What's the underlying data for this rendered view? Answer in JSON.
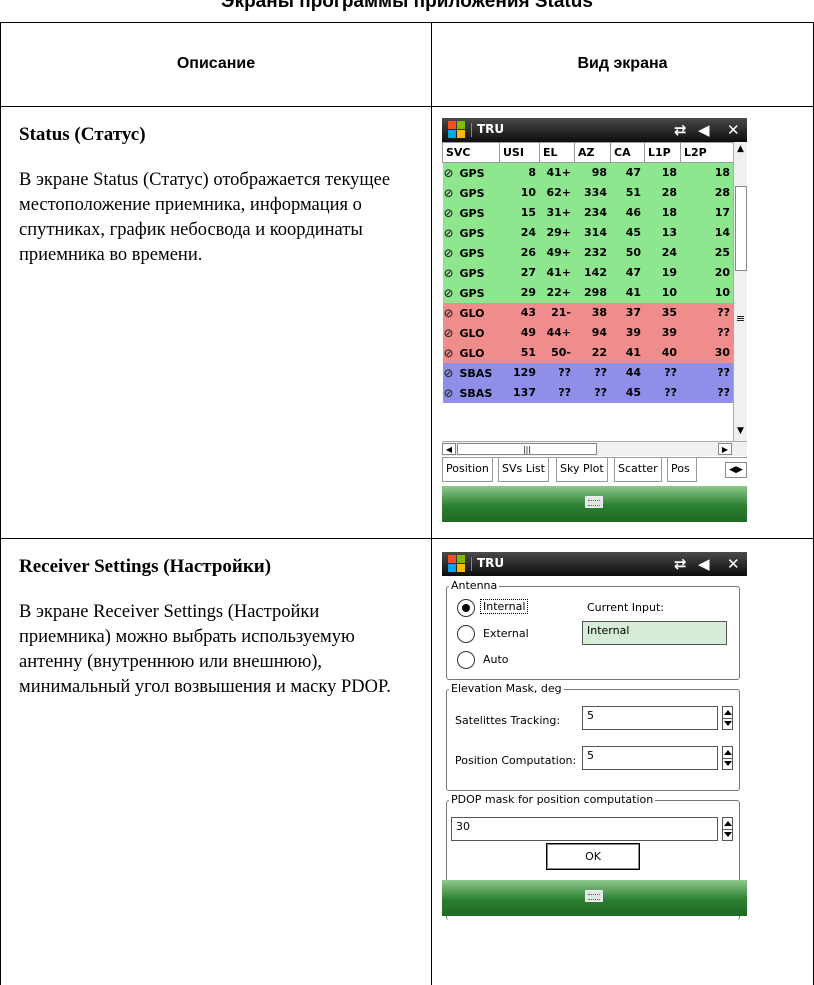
{
  "page_header": "Экраны программы приложения Status",
  "table": {
    "col1_header": "Описание",
    "col2_header": "Вид экрана",
    "rows": [
      {
        "title": "Status (Статус)",
        "text": "В экране Status (Статус) отображается текущее местоположение приемника, информация о спутниках, график небосвода и координаты приемника во времени."
      },
      {
        "title": "Receiver Settings (Настройки)",
        "text": "В экране Receiver Settings (Настройки приемника) можно выбрать используемую антенну (внутреннюю или внешнюю), минимальный угол возвышения и маску PDOP."
      }
    ]
  },
  "screen1": {
    "app_title": "TRU",
    "columns": [
      "SVC",
      "USI",
      "EL",
      "AZ",
      "CA",
      "L1P",
      "L2P"
    ],
    "rows": [
      {
        "type": "gps",
        "svc": "GPS",
        "usi": "8",
        "el": "41+",
        "az": "98",
        "ca": "47",
        "l1p": "18",
        "l2p": "18"
      },
      {
        "type": "gps",
        "svc": "GPS",
        "usi": "10",
        "el": "62+",
        "az": "334",
        "ca": "51",
        "l1p": "28",
        "l2p": "28"
      },
      {
        "type": "gps",
        "svc": "GPS",
        "usi": "15",
        "el": "31+",
        "az": "234",
        "ca": "46",
        "l1p": "18",
        "l2p": "17"
      },
      {
        "type": "gps",
        "svc": "GPS",
        "usi": "24",
        "el": "29+",
        "az": "314",
        "ca": "45",
        "l1p": "13",
        "l2p": "14"
      },
      {
        "type": "gps",
        "svc": "GPS",
        "usi": "26",
        "el": "49+",
        "az": "232",
        "ca": "50",
        "l1p": "24",
        "l2p": "25"
      },
      {
        "type": "gps",
        "svc": "GPS",
        "usi": "27",
        "el": "41+",
        "az": "142",
        "ca": "47",
        "l1p": "19",
        "l2p": "20"
      },
      {
        "type": "gps",
        "svc": "GPS",
        "usi": "29",
        "el": "22+",
        "az": "298",
        "ca": "41",
        "l1p": "10",
        "l2p": "10"
      },
      {
        "type": "glo",
        "svc": "GLO",
        "usi": "43",
        "el": "21-",
        "az": "38",
        "ca": "37",
        "l1p": "35",
        "l2p": "??"
      },
      {
        "type": "glo",
        "svc": "GLO",
        "usi": "49",
        "el": "44+",
        "az": "94",
        "ca": "39",
        "l1p": "39",
        "l2p": "??"
      },
      {
        "type": "glo",
        "svc": "GLO",
        "usi": "51",
        "el": "50-",
        "az": "22",
        "ca": "41",
        "l1p": "40",
        "l2p": "30"
      },
      {
        "type": "sbas",
        "svc": "SBAS",
        "usi": "129",
        "el": "??",
        "az": "??",
        "ca": "44",
        "l1p": "??",
        "l2p": "??"
      },
      {
        "type": "sbas",
        "svc": "SBAS",
        "usi": "137",
        "el": "??",
        "az": "??",
        "ca": "45",
        "l1p": "??",
        "l2p": "??"
      }
    ],
    "tabs": [
      "Position",
      "SVs List",
      "Sky Plot",
      "Scatter",
      "Pos"
    ],
    "row_colors": {
      "gps": "#8ee68e",
      "glo": "#f08c8c",
      "sbas": "#8f8fea"
    }
  },
  "screen2": {
    "app_title": "TRU",
    "antenna": {
      "legend": "Antenna",
      "options": [
        "Internal",
        "External",
        "Auto"
      ],
      "selected": "Internal",
      "current_input_label": "Current Input:",
      "current_input_value": "Internal"
    },
    "elevation": {
      "legend": "Elevation Mask, deg",
      "tracking_label": "Satelittes Tracking:",
      "tracking_value": "5",
      "computation_label": "Position Computation:",
      "computation_value": "5"
    },
    "pdop": {
      "legend": "PDOP mask for position computation",
      "value": "30"
    },
    "ok_label": "OK"
  }
}
